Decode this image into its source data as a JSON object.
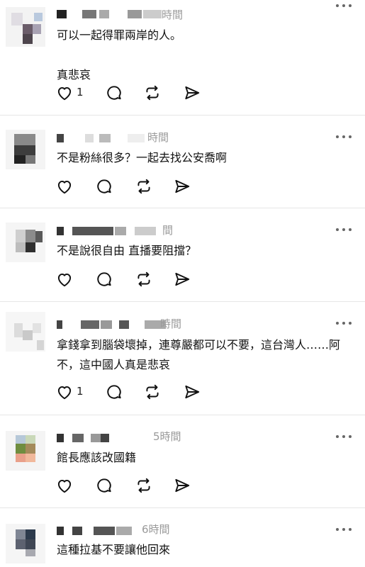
{
  "comments": [
    {
      "time": "時間",
      "text": "可以一起得罪兩岸的人。\n\n真悲哀",
      "like_count": "1"
    },
    {
      "time": "時間",
      "text": "不是粉絲很多？一起去找公安喬啊",
      "like_count": ""
    },
    {
      "time": "間",
      "text": "不是說很自由 直播要阻擋？",
      "like_count": ""
    },
    {
      "time": "時間",
      "text": "拿錢拿到腦袋壞掉，連尊嚴都可以不要，這台灣人……阿不，這中國人真是悲哀",
      "like_count": "1"
    },
    {
      "time": "5時間",
      "text": "館長應該改國籍",
      "like_count": ""
    },
    {
      "time": "6時間",
      "text": "這種拉基不要讓他回來",
      "like_count": ""
    }
  ],
  "icons": {
    "like": "heart-icon",
    "reply": "comment-bubble-icon",
    "repost": "repost-icon",
    "share": "send-icon",
    "more": "more-horizontal-icon"
  },
  "colors": {
    "icon": "#111111",
    "muted": "#9a9a9a",
    "divider": "#e6e6e6"
  }
}
